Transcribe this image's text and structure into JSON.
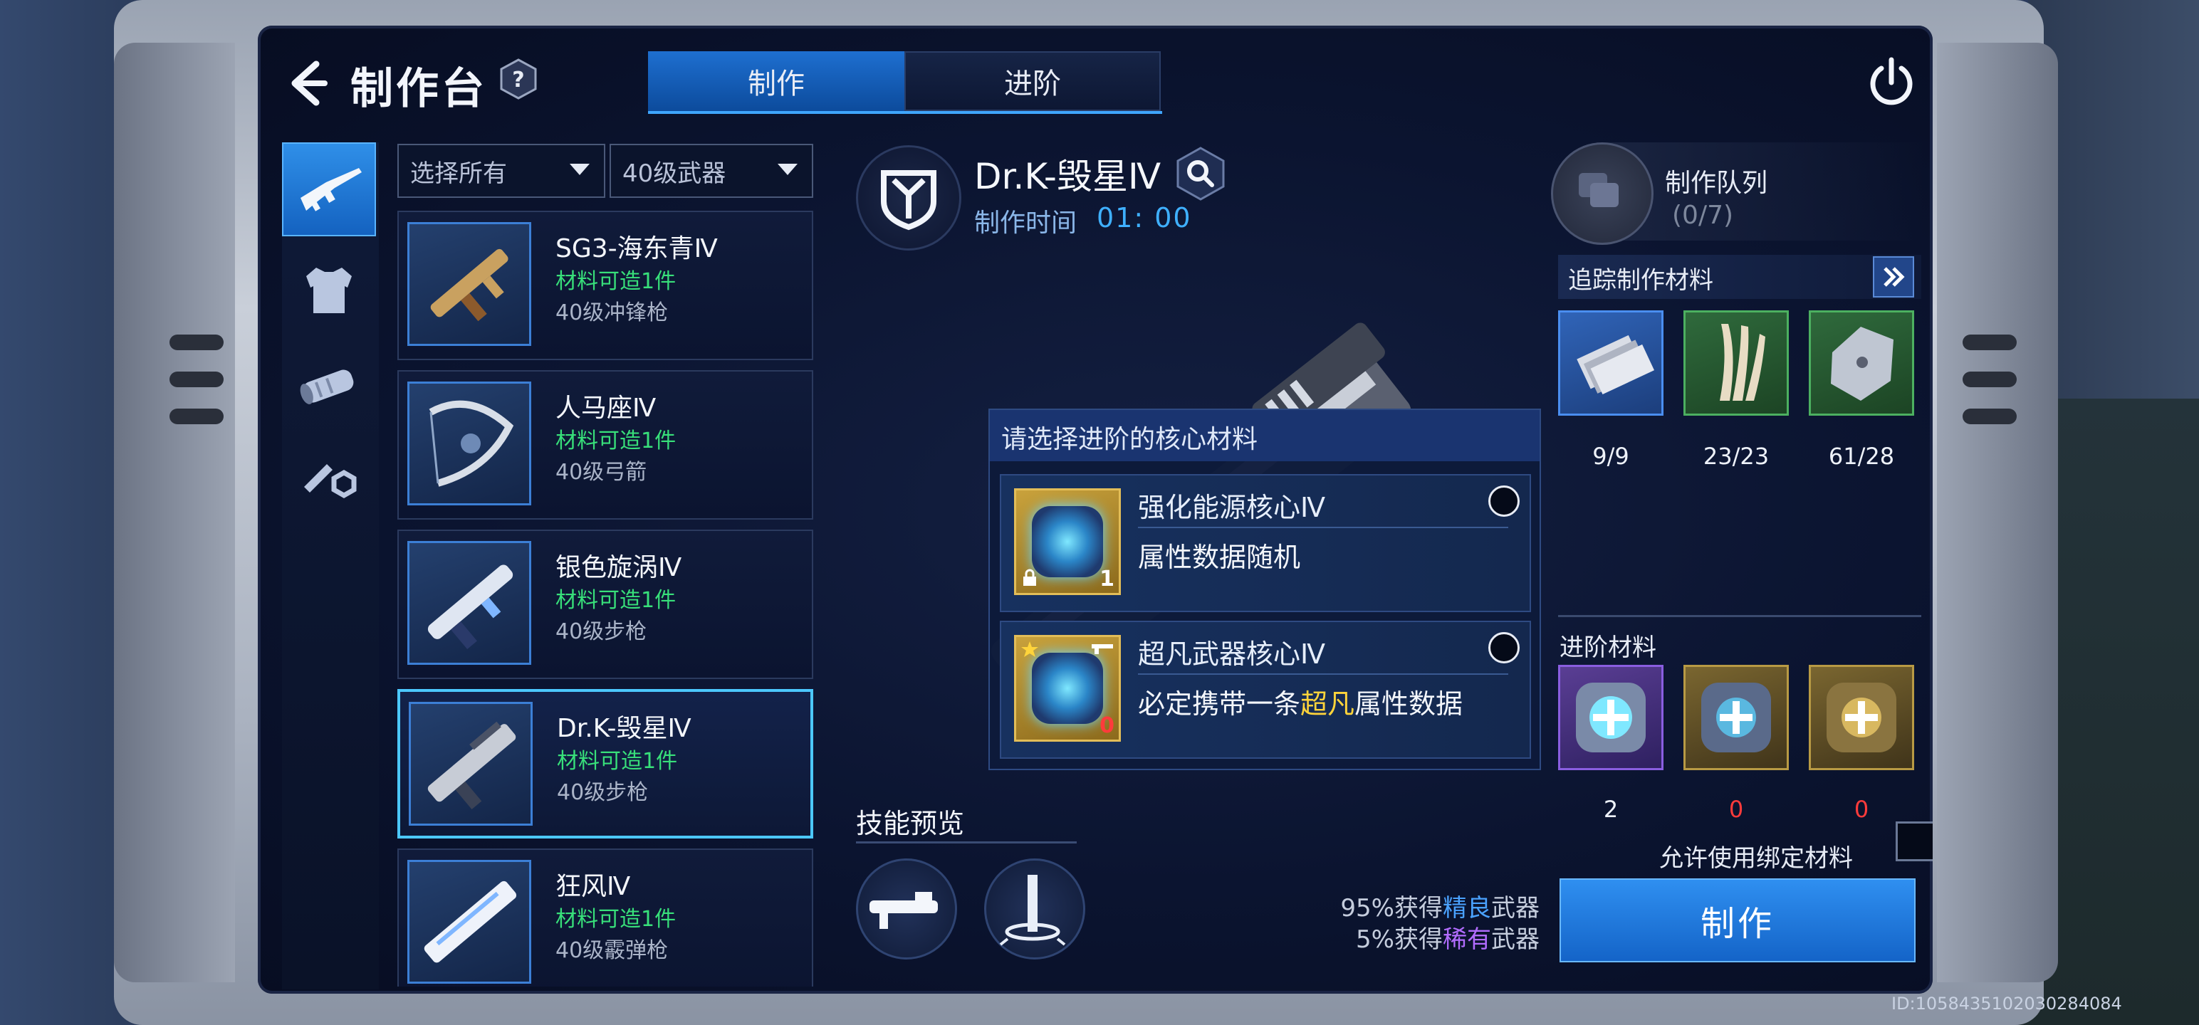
{
  "header": {
    "title": "制作台",
    "help": "?",
    "tabs": [
      {
        "label": "制作",
        "active": true
      },
      {
        "label": "进阶",
        "active": false
      }
    ]
  },
  "categories": [
    {
      "icon": "rifle-icon",
      "active": true
    },
    {
      "icon": "armor-icon",
      "active": false
    },
    {
      "icon": "attachment-icon",
      "active": false
    },
    {
      "icon": "parts-icon",
      "active": false
    }
  ],
  "filters": {
    "scope": "选择所有",
    "level": "40级武器"
  },
  "weapons": [
    {
      "name": "SG3-海东青Ⅳ",
      "craftable": "材料可造1件",
      "type": "40级冲锋枪",
      "selected": false
    },
    {
      "name": "人马座Ⅳ",
      "craftable": "材料可造1件",
      "type": "40级弓箭",
      "selected": false
    },
    {
      "name": "银色旋涡Ⅳ",
      "craftable": "材料可造1件",
      "type": "40级步枪",
      "selected": false
    },
    {
      "name": "Dr.K-毁星Ⅳ",
      "craftable": "材料可造1件",
      "type": "40级步枪",
      "selected": true
    },
    {
      "name": "狂风Ⅳ",
      "craftable": "材料可造1件",
      "type": "40级霰弹枪",
      "selected": false
    }
  ],
  "detail": {
    "name": "Dr.K-毁星Ⅳ",
    "time_label": "制作时间",
    "time_value": "01: 00",
    "skill_title": "技能预览"
  },
  "popup": {
    "title": "请选择进阶的核心材料",
    "options": [
      {
        "name": "强化能源核心Ⅳ",
        "desc": "属性数据随机",
        "count": "1"
      },
      {
        "name": "超凡武器核心Ⅳ",
        "desc_pre": "必定携带一条",
        "desc_hl": "超凡",
        "desc_post": "属性数据",
        "count": "0"
      }
    ]
  },
  "queue": {
    "label": "制作队列",
    "count": "(0/7)"
  },
  "tracking": {
    "label": "追踪制作材料",
    "materials": [
      {
        "icon": "metal-plates-icon",
        "rarity": "blue",
        "count": "9/9"
      },
      {
        "icon": "claw-icon",
        "rarity": "green",
        "count": "23/23"
      },
      {
        "icon": "armor-plate-icon",
        "rarity": "green",
        "count": "61/28"
      }
    ]
  },
  "advance": {
    "label": "进阶材料",
    "materials": [
      {
        "icon": "core-purple-icon",
        "rarity": "purple",
        "count": "2"
      },
      {
        "icon": "core-gold-icon",
        "rarity": "gold",
        "count": "0"
      },
      {
        "icon": "core-gold-icon",
        "rarity": "gold",
        "count": "0"
      }
    ]
  },
  "bind": {
    "label": "允许使用绑定材料"
  },
  "rates": [
    {
      "pre": "95%获得",
      "hl": "精良",
      "post": "武器",
      "kind": "fine"
    },
    {
      "pre": "5%获得",
      "hl": "稀有",
      "post": "武器",
      "kind": "rare"
    }
  ],
  "make_button": "制作",
  "footer_id": "ID:1058435102030284084",
  "colors": {
    "accent": "#1e6fd0",
    "craftable_green": "#38e07a",
    "warning_red": "#ff3b3b",
    "highlight_yellow": "#ffd43b",
    "fine_blue": "#4aa2ff",
    "rare_purple": "#b26cff"
  }
}
